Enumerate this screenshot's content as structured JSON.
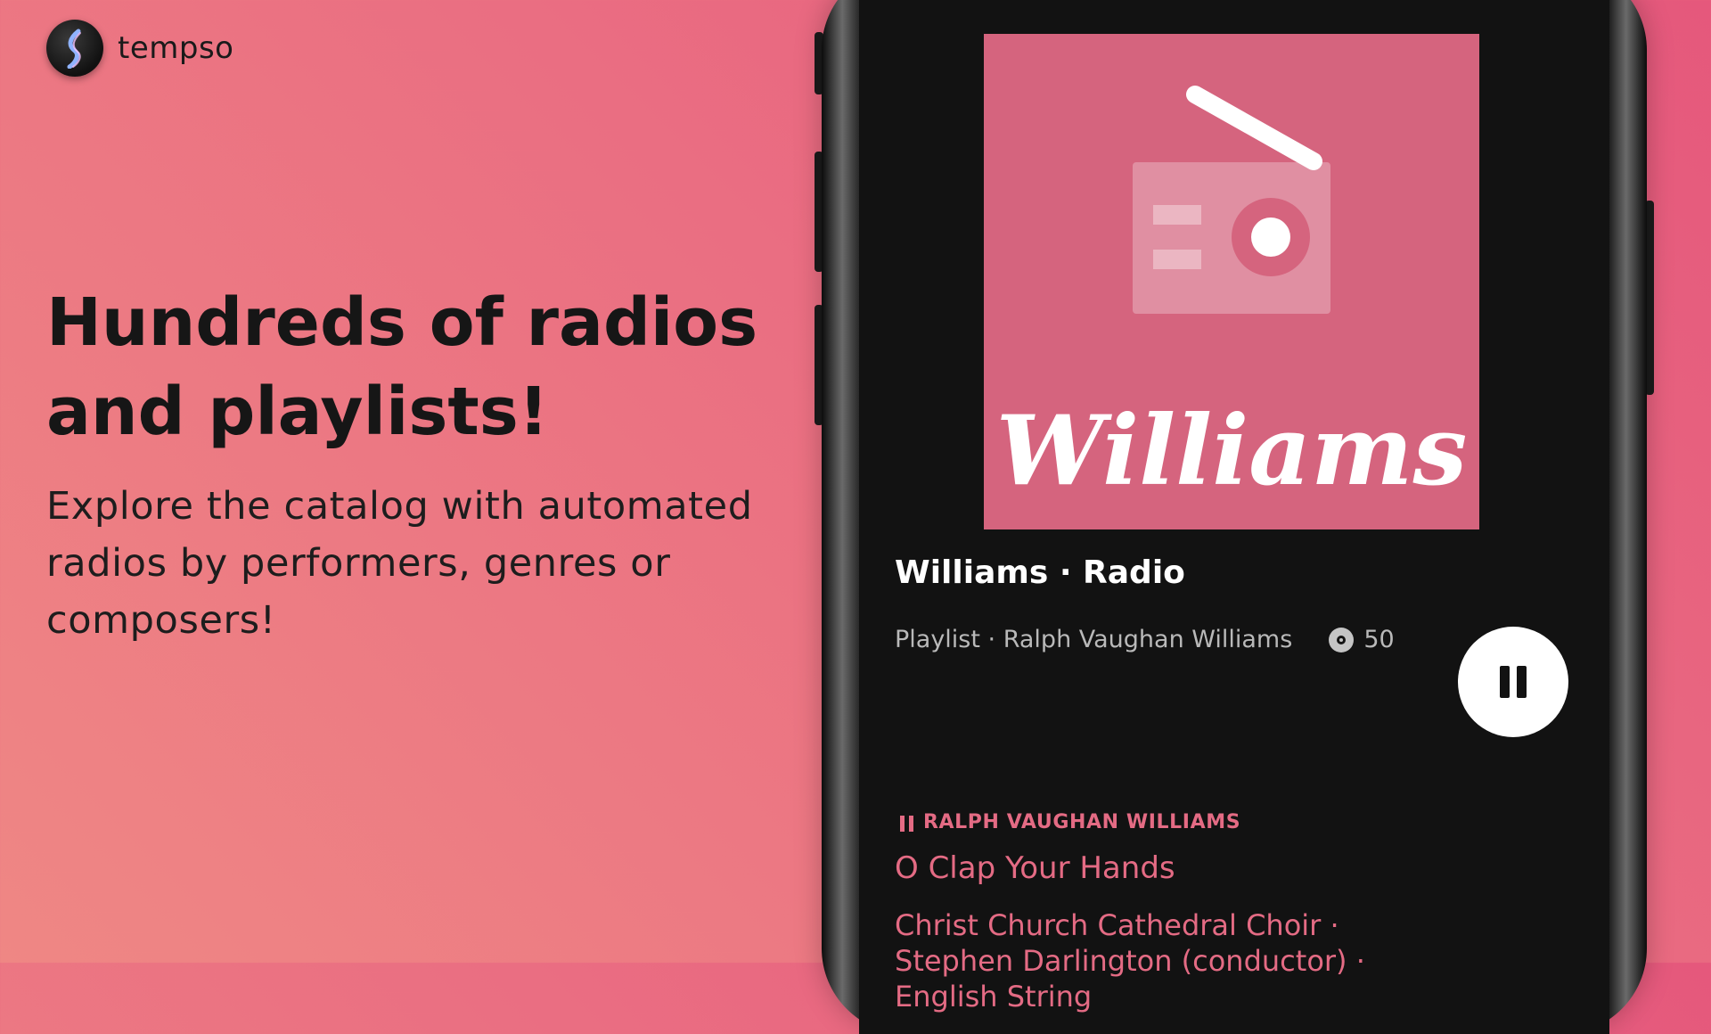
{
  "brand": {
    "name": "tempso",
    "logo_icon": "music-note-icon"
  },
  "promo": {
    "headline": "Hundreds of radios and playlists!",
    "subtext": "Explore the catalog with automated radios by performers, genres or composers!"
  },
  "player": {
    "cover": {
      "icon": "radio-icon",
      "text": "Williams",
      "background": "#d5647e"
    },
    "title": "Williams · Radio",
    "meta": "Playlist · Ralph Vaughan Williams",
    "track_count": "50",
    "pause_icon": "pause-icon",
    "now_playing": {
      "artist": "RALPH VAUGHAN WILLIAMS",
      "title": "O Clap Your Hands",
      "performers": "Christ Church Cathedral Choir · Stephen Darlington (conductor) · English String"
    }
  },
  "colors": {
    "accent": "#e46b84",
    "screen_bg": "#121212"
  }
}
